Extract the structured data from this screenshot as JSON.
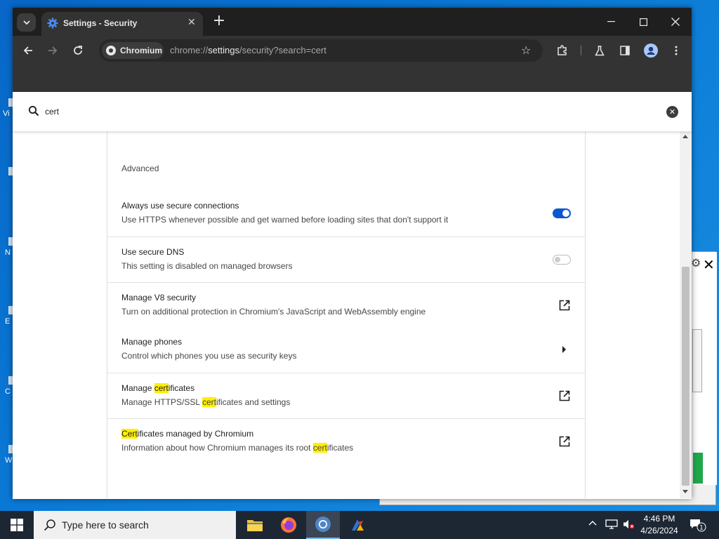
{
  "browser": {
    "tab_title": "Settings - Security",
    "chip_label": "Chromium",
    "url_scheme": "chrome://",
    "url_host": "settings",
    "url_path": "/security?search=cert"
  },
  "search": {
    "value": "cert"
  },
  "settings": {
    "section_title": "Advanced",
    "rows": [
      {
        "title": "Always use secure connections",
        "subtitle": "Use HTTPS whenever possible and get warned before loading sites that don't support it",
        "control": "toggle-on"
      },
      {
        "title": "Use secure DNS",
        "subtitle": "This setting is disabled on managed browsers",
        "control": "toggle-off-disabled"
      },
      {
        "title": "Manage V8 security",
        "subtitle": "Turn on additional protection in Chromium's JavaScript and WebAssembly engine",
        "control": "external-link-icon"
      },
      {
        "title": "Manage phones",
        "subtitle": "Control which phones you use as security keys",
        "control": "arrow-right-icon"
      },
      {
        "title_pre": "Manage ",
        "title_hl": "cert",
        "title_post": "ificates",
        "sub_pre": "Manage HTTPS/SSL ",
        "sub_hl": "cert",
        "sub_post": "ificates and settings",
        "control": "external-link-icon"
      },
      {
        "title_pre": "",
        "title_hl": "Cert",
        "title_post": "ificates managed by Chromium",
        "sub_pre": "Information about how Chromium manages its root ",
        "sub_hl": "cert",
        "sub_post": "ificates",
        "control": "external-link-icon"
      }
    ]
  },
  "taskbar": {
    "search_placeholder": "Type here to search",
    "time": "4:46 PM",
    "date": "4/26/2024",
    "notification_count": "1"
  },
  "colors": {
    "highlight": "#ffef00",
    "toggle_on": "#0b57d0",
    "desktop": "#0a78d4"
  }
}
